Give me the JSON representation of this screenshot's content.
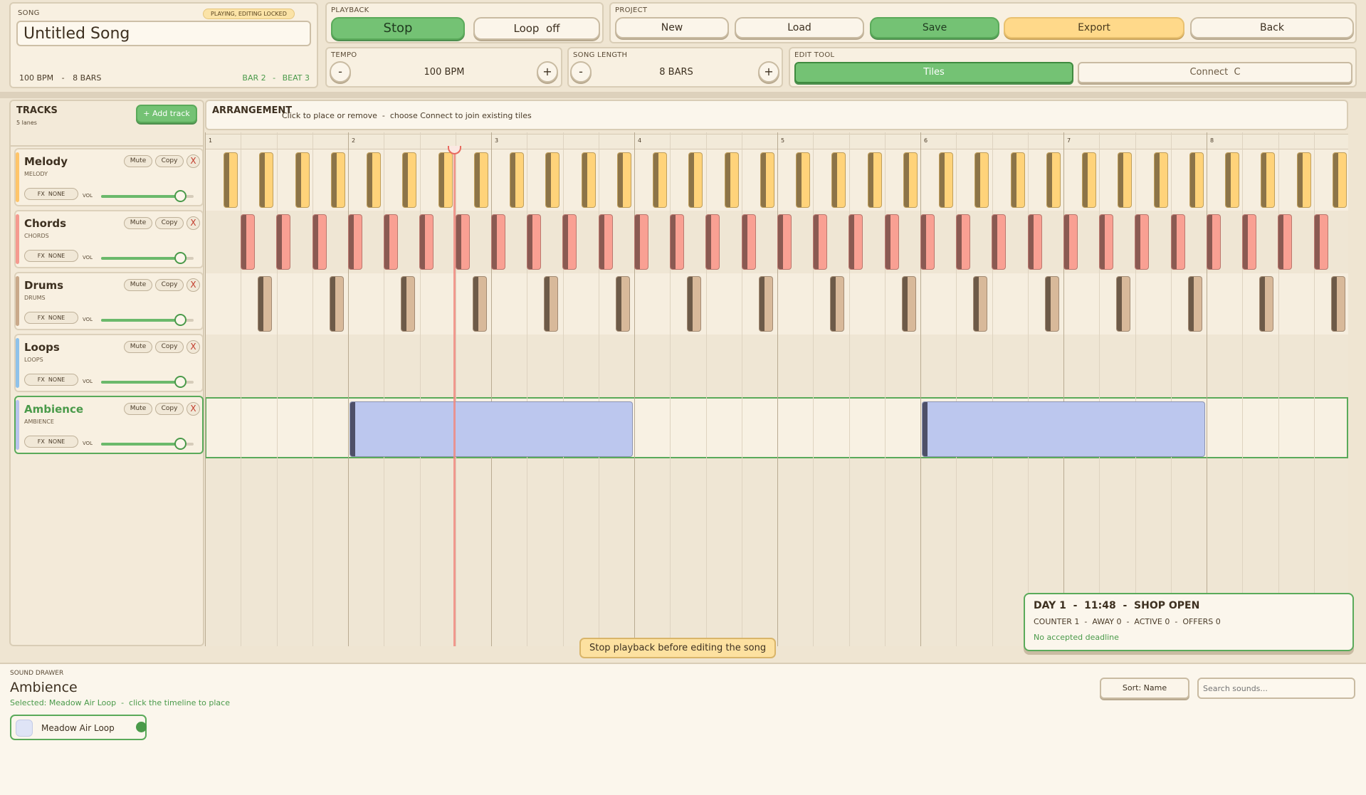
{
  "song": {
    "section": "SONG",
    "badge": "PLAYING, EDITING LOCKED",
    "title": "Untitled Song",
    "bpm": "100 BPM",
    "bars": "8 BARS",
    "bar_pos": "BAR 2",
    "beat_pos": "BEAT 3",
    "sep": "-"
  },
  "playback": {
    "section": "PLAYBACK",
    "stop": "Stop",
    "loop": "Loop  off"
  },
  "project": {
    "section": "PROJECT",
    "new": "New",
    "load": "Load",
    "save": "Save",
    "export": "Export",
    "back": "Back"
  },
  "tempo": {
    "section": "TEMPO",
    "value": "100 BPM",
    "minus": "-",
    "plus": "+"
  },
  "length": {
    "section": "SONG LENGTH",
    "value": "8 BARS",
    "minus": "-",
    "plus": "+"
  },
  "edit_tool": {
    "section": "EDIT TOOL",
    "tiles": "Tiles",
    "connect": "Connect  C"
  },
  "tracks_panel": {
    "title": "TRACKS",
    "lanes": "5 lanes",
    "add": "+ Add track"
  },
  "tracks": [
    {
      "name": "Melody",
      "sub": "MELODY",
      "color": "#ffc56a",
      "mute": "Mute",
      "copy": "Copy",
      "x": "X",
      "fx": "FX  NONE",
      "vol": "VOL",
      "volume": 0.85
    },
    {
      "name": "Chords",
      "sub": "CHORDS",
      "color": "#f59a90",
      "mute": "Mute",
      "copy": "Copy",
      "x": "X",
      "fx": "FX  NONE",
      "vol": "VOL",
      "volume": 0.85
    },
    {
      "name": "Drums",
      "sub": "DRUMS",
      "color": "#c9a98a",
      "mute": "Mute",
      "copy": "Copy",
      "x": "X",
      "fx": "FX  NONE",
      "vol": "VOL",
      "volume": 0.85
    },
    {
      "name": "Loops",
      "sub": "LOOPS",
      "color": "#8fc2ea",
      "mute": "Mute",
      "copy": "Copy",
      "x": "X",
      "fx": "FX  NONE",
      "vol": "VOL",
      "volume": 0.85
    },
    {
      "name": "Ambience",
      "sub": "AMBIENCE",
      "color": "#b9c3ee",
      "mute": "Mute",
      "copy": "Copy",
      "x": "X",
      "fx": "FX  NONE",
      "vol": "VOL",
      "volume": 0.85
    }
  ],
  "arrangement": {
    "title": "ARRANGEMENT",
    "hint": "Click to place or remove  -  choose Connect to join existing tiles"
  },
  "ruler": [
    "1",
    "2",
    "3",
    "4",
    "5",
    "6",
    "7",
    "8"
  ],
  "colors": {
    "melody_tile": "#ffd37a",
    "melody_edge": "#8c7448",
    "chords_tile": "#f9a093",
    "chords_edge": "#8a5a52",
    "drums_tile": "#d8b99a",
    "drums_edge": "#6d5a48",
    "amb_tile": "#bcc7ee",
    "amb_edge": "#4e5068"
  },
  "toast": "Stop playback before editing the song",
  "status": {
    "day_line": "DAY 1  -  11:48  -  SHOP OPEN",
    "counts": "COUNTER 1  -  AWAY 0  -  ACTIVE 0  -  OFFERS 0",
    "deadline": "No accepted deadline"
  },
  "drawer": {
    "section": "SOUND DRAWER",
    "title": "Ambience",
    "selected": "Selected: Meadow Air Loop  -  click the timeline to place",
    "sort": "Sort: Name",
    "search_placeholder": "Search sounds...",
    "sound": "Meadow Air Loop"
  }
}
